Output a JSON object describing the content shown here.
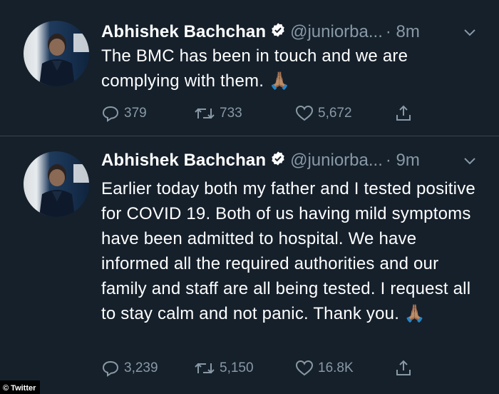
{
  "tweets": [
    {
      "author": "Abhishek Bachchan",
      "handle": "@juniorba...",
      "time": "· 8m",
      "text": "The BMC has been in touch and we are complying with them. 🙏🏽",
      "stats": {
        "replies": "379",
        "retweets": "733",
        "likes": "5,672"
      }
    },
    {
      "author": "Abhishek Bachchan",
      "handle": "@juniorba...",
      "time": "· 9m",
      "text": "Earlier today both my father and I tested positive for COVID 19. Both of us having mild symptoms have been admitted to hospital. We have informed all the required authorities and our family and staff are all being tested. I request all to stay calm and not panic. Thank you. 🙏🏽",
      "stats": {
        "replies": "3,239",
        "retweets": "5,150",
        "likes": "16.8K"
      }
    }
  ],
  "credit": "© Twitter",
  "colors": {
    "background": "#15202b",
    "secondary_text": "#8899a6",
    "divider": "#38444d"
  },
  "icons": [
    "verified-badge-icon",
    "chevron-down-icon",
    "reply-icon",
    "retweet-icon",
    "like-icon",
    "share-icon"
  ]
}
